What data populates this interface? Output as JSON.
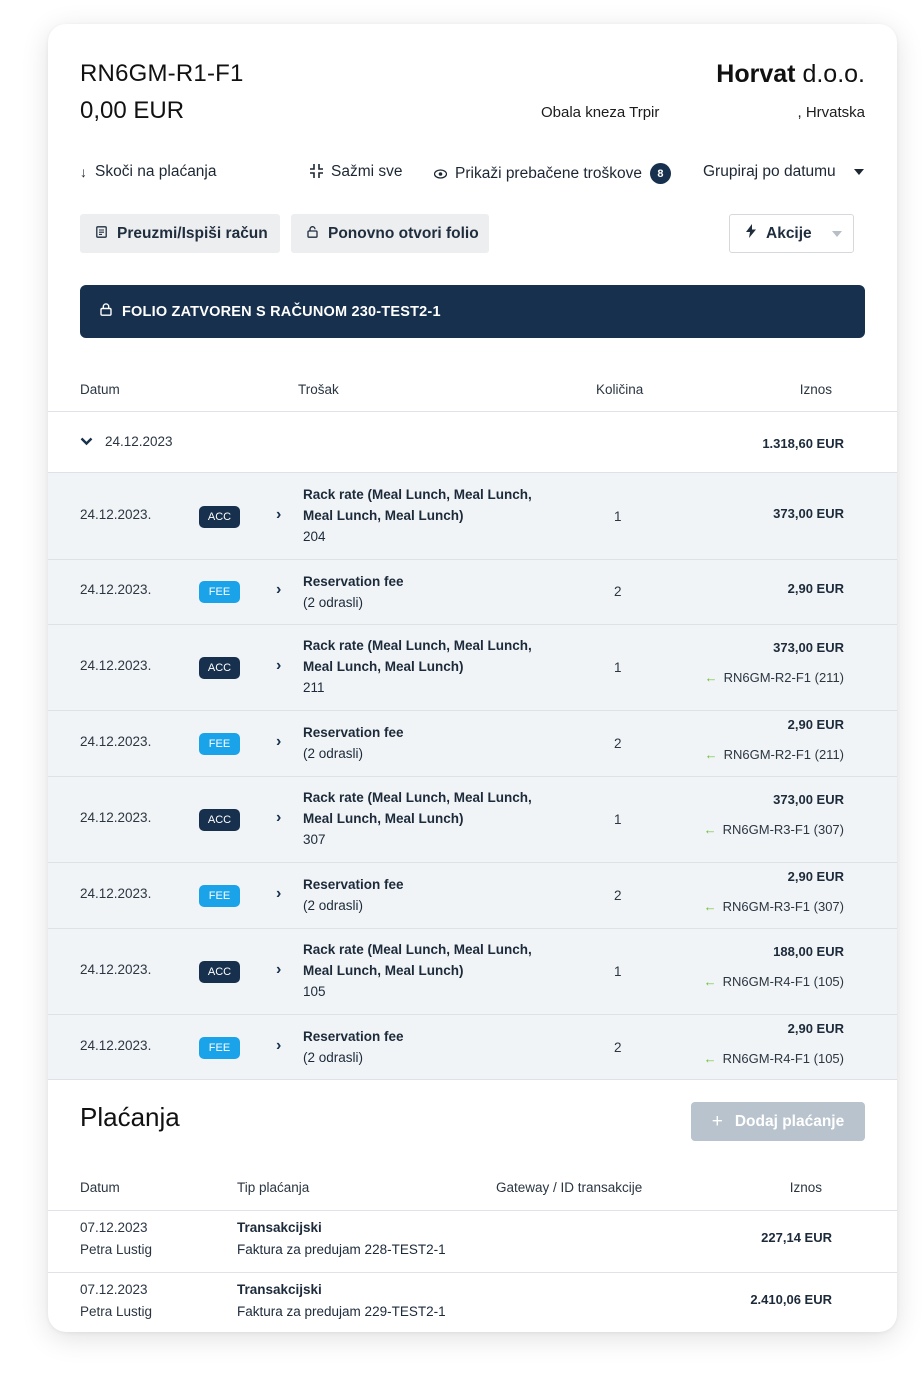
{
  "header": {
    "folio_id": "RN6GM-R1-F1",
    "balance": "0,00 EUR",
    "company_name_bold": "Horvat",
    "company_suffix": "d.o.o.",
    "address_street": "Obala kneza Trpir",
    "address_country": ", Hrvatska"
  },
  "toolbar": {
    "jump_to_payments": "Skoči na plaćanja",
    "collapse_all": "Sažmi sve",
    "show_transferred": "Prikaži prebačene troškove",
    "transferred_count": "8",
    "group_by": "Grupiraj po datumu"
  },
  "actions": {
    "download_print": "Preuzmi/Ispiši račun",
    "reopen_folio": "Ponovno otvori folio",
    "actions_menu": "Akcije"
  },
  "banner": {
    "text": "FOLIO ZATVOREN S RAČUNOM 230-TEST2-1"
  },
  "charges_table": {
    "headers": {
      "date": "Datum",
      "charge": "Trošak",
      "quantity": "Količina",
      "amount": "Iznos"
    },
    "group": {
      "date": "24.12.2023",
      "total": "1.318,60 EUR"
    },
    "rows": [
      {
        "date": "24.12.2023.",
        "tag": "ACC",
        "line1": "Rack rate (Meal Lunch, Meal Lunch,",
        "line2": "Meal Lunch, Meal Lunch)",
        "line3": "204",
        "qty": "1",
        "amount": "373,00 EUR",
        "link": ""
      },
      {
        "date": "24.12.2023.",
        "tag": "FEE",
        "line1": "Reservation fee",
        "line2": "(2 odrasli)",
        "line3": "",
        "qty": "2",
        "amount": "2,90 EUR",
        "link": ""
      },
      {
        "date": "24.12.2023.",
        "tag": "ACC",
        "line1": "Rack rate (Meal Lunch, Meal Lunch,",
        "line2": "Meal Lunch, Meal Lunch)",
        "line3": "211",
        "qty": "1",
        "amount": "373,00 EUR",
        "link": "RN6GM-R2-F1 (211)"
      },
      {
        "date": "24.12.2023.",
        "tag": "FEE",
        "line1": "Reservation fee",
        "line2": "(2 odrasli)",
        "line3": "",
        "qty": "2",
        "amount": "2,90 EUR",
        "link": "RN6GM-R2-F1 (211)"
      },
      {
        "date": "24.12.2023.",
        "tag": "ACC",
        "line1": "Rack rate (Meal Lunch, Meal Lunch,",
        "line2": "Meal Lunch, Meal Lunch)",
        "line3": "307",
        "qty": "1",
        "amount": "373,00 EUR",
        "link": "RN6GM-R3-F1 (307)"
      },
      {
        "date": "24.12.2023.",
        "tag": "FEE",
        "line1": "Reservation fee",
        "line2": "(2 odrasli)",
        "line3": "",
        "qty": "2",
        "amount": "2,90 EUR",
        "link": "RN6GM-R3-F1 (307)"
      },
      {
        "date": "24.12.2023.",
        "tag": "ACC",
        "line1": "Rack rate (Meal Lunch, Meal Lunch,",
        "line2": "Meal Lunch, Meal Lunch)",
        "line3": "105",
        "qty": "1",
        "amount": "188,00 EUR",
        "link": "RN6GM-R4-F1 (105)"
      },
      {
        "date": "24.12.2023.",
        "tag": "FEE",
        "line1": "Reservation fee",
        "line2": "(2 odrasli)",
        "line3": "",
        "qty": "2",
        "amount": "2,90 EUR",
        "link": "RN6GM-R4-F1 (105)"
      }
    ]
  },
  "payments": {
    "title": "Plaćanja",
    "add_button": "Dodaj plaćanje",
    "headers": {
      "date": "Datum",
      "type": "Tip plaćanja",
      "gateway": "Gateway / ID transakcije",
      "amount": "Iznos"
    },
    "rows": [
      {
        "date": "07.12.2023",
        "user": "Petra Lustig",
        "type": "Transakcijski",
        "ref": "Faktura za predujam 228-TEST2-1",
        "amount": "227,14 EUR"
      },
      {
        "date": "07.12.2023",
        "user": "Petra Lustig",
        "type": "Transakcijski",
        "ref": "Faktura za predujam 229-TEST2-1",
        "amount": "2.410,06 EUR"
      }
    ]
  },
  "colors": {
    "navy": "#17304d",
    "fee_blue": "#1aa3e8",
    "row_bg": "#f1f4f6",
    "link_arrow_green": "#6fbf3a",
    "disabled_button": "#b8c3cd"
  },
  "icons": {
    "jump": "arrow-down-icon",
    "collapse": "collapse-icon",
    "eye": "eye-icon",
    "print": "document-icon",
    "lock": "lock-icon",
    "bolt": "bolt-icon",
    "chevron_down": "chevron-down-icon",
    "chevron_right": "chevron-right-icon",
    "arrow_left": "arrow-left-icon",
    "plus": "plus-icon"
  }
}
